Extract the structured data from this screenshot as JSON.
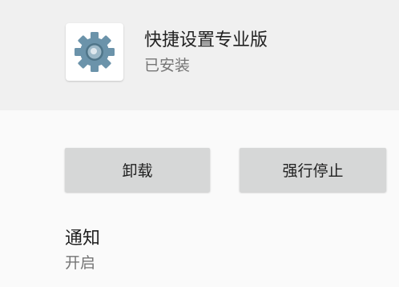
{
  "app": {
    "name": "快捷设置专业版",
    "status": "已安装",
    "icon": "gear-icon"
  },
  "actions": {
    "uninstall_label": "卸载",
    "force_stop_label": "强行停止"
  },
  "notifications": {
    "title": "通知",
    "value": "开启"
  },
  "colors": {
    "header_bg": "#f0f0f0",
    "page_bg": "#fafafa",
    "button_bg": "#d6d7d7",
    "gear_color": "#6b93aa",
    "primary_text": "#212121",
    "secondary_text": "#757575"
  }
}
